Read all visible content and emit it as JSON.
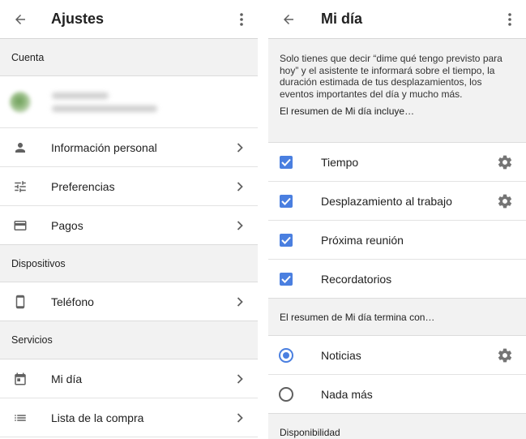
{
  "colors": {
    "accent": "#4a7fe0",
    "section_bg": "#f2f2f2",
    "icon": "#616161"
  },
  "left": {
    "title": "Ajustes",
    "sections": {
      "cuenta": "Cuenta",
      "dispositivos": "Dispositivos",
      "servicios": "Servicios"
    },
    "items": {
      "info_personal": "Información personal",
      "preferencias": "Preferencias",
      "pagos": "Pagos",
      "telefono": "Teléfono",
      "mi_dia": "Mi día",
      "lista_compra": "Lista de la compra"
    }
  },
  "right": {
    "title": "Mi día",
    "description": "Solo tienes que decir “dime qué tengo previsto para hoy” y el asistente te informará sobre el tiempo, la duración estimada de tus desplazamientos, los eventos importantes del día y mucho más.",
    "includes_header": "El resumen de Mi día incluye…",
    "includes": [
      {
        "label": "Tiempo",
        "checked": true,
        "has_settings": true
      },
      {
        "label": "Desplazamiento al trabajo",
        "checked": true,
        "has_settings": true
      },
      {
        "label": "Próxima reunión",
        "checked": true,
        "has_settings": false
      },
      {
        "label": "Recordatorios",
        "checked": true,
        "has_settings": false
      }
    ],
    "ends_header": "El resumen de Mi día termina con…",
    "ends": [
      {
        "label": "Noticias",
        "selected": true,
        "has_settings": true
      },
      {
        "label": "Nada más",
        "selected": false,
        "has_settings": false
      }
    ],
    "availability_header": "Disponibilidad"
  }
}
